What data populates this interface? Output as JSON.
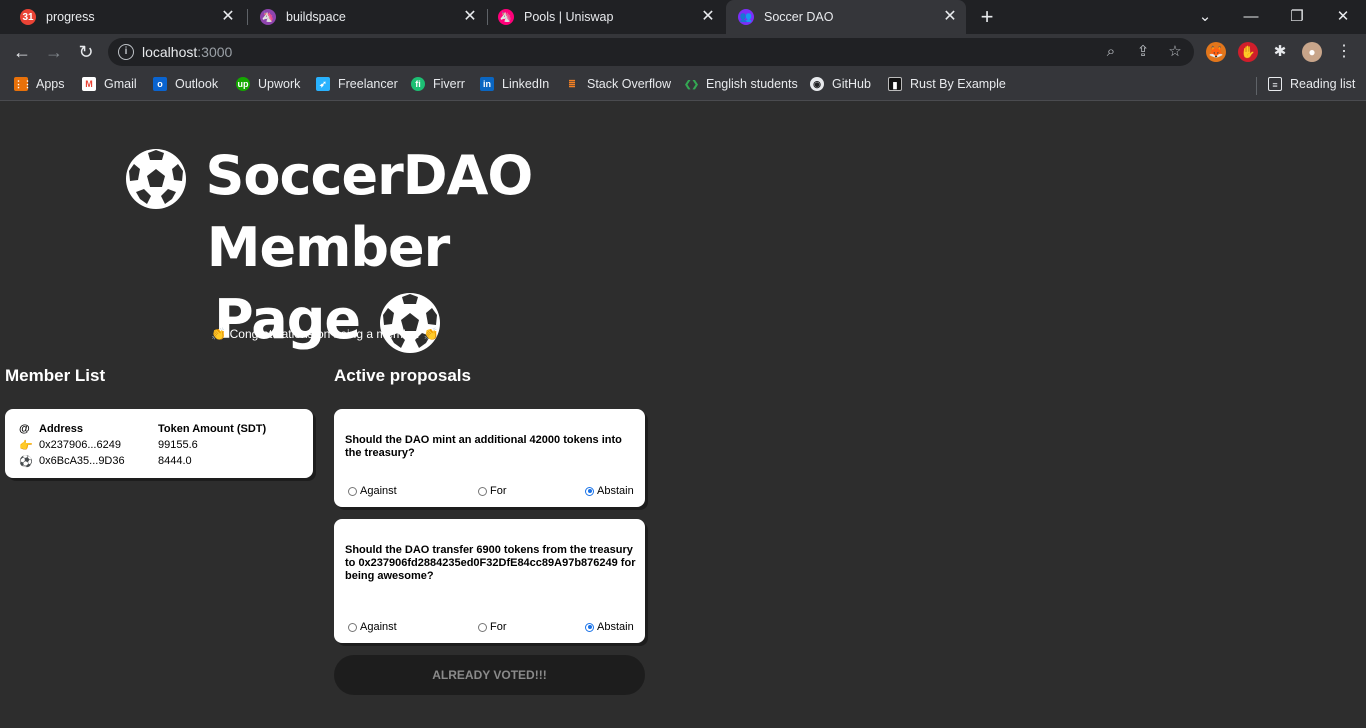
{
  "browser": {
    "tabs": [
      {
        "title": "progress",
        "icon": "google-calendar-icon",
        "color": "#ea4335"
      },
      {
        "title": "buildspace",
        "icon": "buildspace-unicorn-icon",
        "color": "#8e44ad"
      },
      {
        "title": "Pools | Uniswap",
        "icon": "uniswap-icon",
        "color": "#ff007a"
      },
      {
        "title": "Soccer DAO",
        "icon": "soccer-dao-icon",
        "color": "#7b2ff7"
      }
    ],
    "url_host": "localhost",
    "url_port": ":3000",
    "bookmarks": [
      {
        "label": "Apps",
        "icon": "apps-grid-icon"
      },
      {
        "label": "Gmail",
        "icon": "gmail-icon"
      },
      {
        "label": "Outlook",
        "icon": "outlook-icon"
      },
      {
        "label": "Upwork",
        "icon": "upwork-icon"
      },
      {
        "label": "Freelancer",
        "icon": "freelancer-icon"
      },
      {
        "label": "Fiverr",
        "icon": "fiverr-icon"
      },
      {
        "label": "LinkedIn",
        "icon": "linkedin-icon"
      },
      {
        "label": "Stack Overflow",
        "icon": "stackoverflow-icon"
      },
      {
        "label": "English students",
        "icon": "english-students-icon"
      },
      {
        "label": "GitHub",
        "icon": "github-icon"
      },
      {
        "label": "Rust By Example",
        "icon": "book-icon"
      }
    ],
    "reading_list": "Reading list"
  },
  "page": {
    "title_line1": "SoccerDAO Member",
    "title_line2": "Page",
    "congrats": "👏 Congratulations on being a member 👏",
    "member_list_title": "Member List",
    "proposals_title": "Active proposals",
    "members": {
      "header": {
        "icon": "@",
        "address": "Address",
        "amount": "Token Amount (SDT)"
      },
      "rows": [
        {
          "address": "0x237906...6249",
          "amount": "99155.6"
        },
        {
          "address": "0x6BcA35...9D36",
          "amount": "8444.0"
        }
      ]
    },
    "proposals": [
      {
        "text": "Should the DAO mint an additional 42000 tokens into the treasury?",
        "options": [
          "Against",
          "For",
          "Abstain"
        ],
        "selected": "Abstain"
      },
      {
        "text": "Should the DAO transfer 6900 tokens from the treasury to 0x237906fd2884235ed0F32DfE84cc89A97b876249 for being awesome?",
        "options": [
          "Against",
          "For",
          "Abstain"
        ],
        "selected": "Abstain"
      }
    ],
    "submit_label": "ALREADY VOTED!!!"
  }
}
